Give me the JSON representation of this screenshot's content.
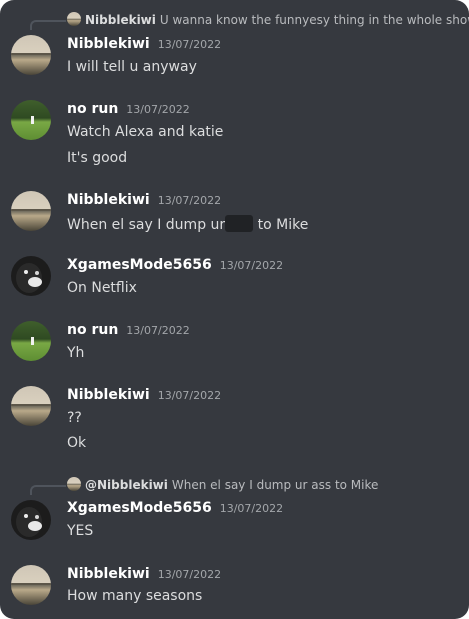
{
  "messages": [
    {
      "reply": {
        "name": "Nibblekiwi",
        "text": "U wanna know the funnyesy thing in the whole show"
      },
      "author": "Nibblekiwi",
      "time": "13/07/2022",
      "lines": [
        "I will tell u anyway"
      ]
    },
    {
      "author": "no run",
      "time": "13/07/2022",
      "lines": [
        "Watch Alexa and katie",
        "It's good"
      ]
    },
    {
      "author": "Nibblekiwi",
      "time": "13/07/2022",
      "line_before": "When el say I dump ur",
      "line_after": "to Mike"
    },
    {
      "author": "XgamesMode5656",
      "time": "13/07/2022",
      "lines": [
        "On Netflix"
      ]
    },
    {
      "author": "no run",
      "time": "13/07/2022",
      "lines": [
        "Yh"
      ]
    },
    {
      "author": "Nibblekiwi",
      "time": "13/07/2022",
      "lines": [
        "??",
        "Ok"
      ]
    },
    {
      "reply": {
        "name": "@Nibblekiwi",
        "text": "When el say I dump ur ass to Mike"
      },
      "author": "XgamesMode5656",
      "time": "13/07/2022",
      "lines": [
        "YES"
      ]
    },
    {
      "author": "Nibblekiwi",
      "time": "13/07/2022",
      "lines": [
        "How many seasons"
      ]
    }
  ]
}
